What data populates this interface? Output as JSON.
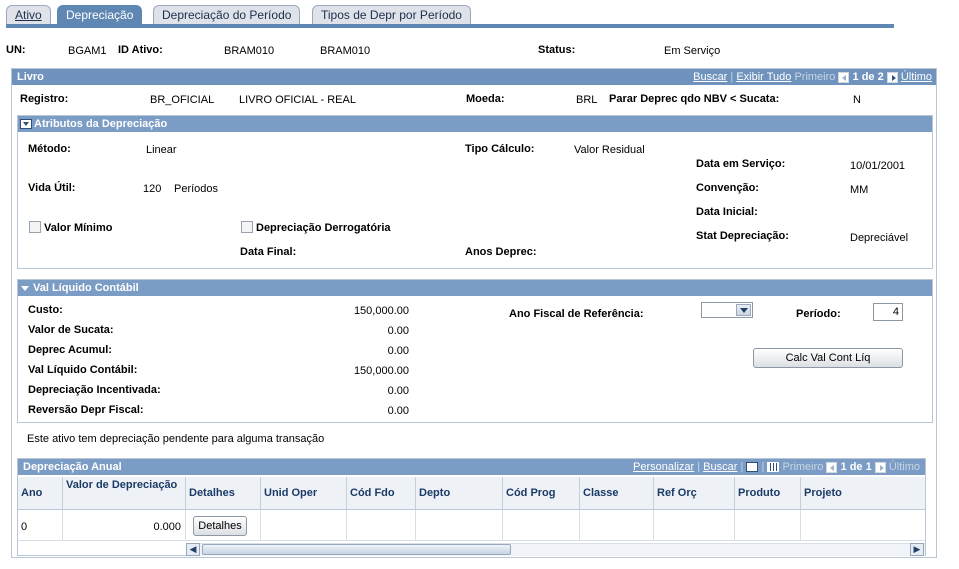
{
  "tabs": [
    {
      "label": "Ativo"
    },
    {
      "label": "Depreciação"
    },
    {
      "label": "Depreciação do Período"
    },
    {
      "label": "Tipos de Depr por Período"
    }
  ],
  "top": {
    "un_label": "UN:",
    "un_value": "BGAM1",
    "asset_label": "ID Ativo:",
    "asset_value": "BRAM010",
    "asset_value2": "BRAM010",
    "status_label": "Status:",
    "status_value": "Em Serviço"
  },
  "livro": {
    "title": "Livro",
    "nav": {
      "search": "Buscar",
      "view_all": "Exibir Tudo",
      "first": "Primeiro",
      "count": "1 de 2",
      "last": "Último"
    },
    "registro_label": "Registro:",
    "registro_code": "BR_OFICIAL",
    "registro_desc": "LIVRO OFICIAL - REAL",
    "moeda_label": "Moeda:",
    "moeda_value": "BRL",
    "parar_label": "Parar Deprec qdo NBV < Sucata:",
    "parar_value": "N"
  },
  "atributos": {
    "title": "Atributos da Depreciação",
    "metodo_label": "Método:",
    "metodo_value": "Linear",
    "tipo_calc_label": "Tipo Cálculo:",
    "tipo_calc_value": "Valor Residual",
    "data_servico_label": "Data em Serviço:",
    "data_servico_value": "10/01/2001",
    "vida_util_label": "Vida Útil:",
    "vida_util_value": "120",
    "vida_util_unit": "Períodos",
    "convencao_label": "Convenção:",
    "convencao_value": "MM",
    "data_inicial_label": "Data Inicial:",
    "valor_minimo_label": "Valor Mínimo",
    "derrogatoria_label": "Depreciação Derrogatória",
    "stat_dep_label": "Stat Depreciação:",
    "stat_dep_value": "Depreciável",
    "data_final_label": "Data Final:",
    "anos_deprec_label": "Anos Deprec:"
  },
  "valor_liquido": {
    "title": "Val Líquido Contábil",
    "rows": [
      {
        "label": "Custo:",
        "value": "150,000.00"
      },
      {
        "label": "Valor de Sucata:",
        "value": "0.00"
      },
      {
        "label": "Deprec Acumul:",
        "value": "0.00"
      },
      {
        "label": "Val Líquido Contábil:",
        "value": "150,000.00"
      },
      {
        "label": "Depreciação Incentivada:",
        "value": "0.00"
      },
      {
        "label": "Reversão Depr Fiscal:",
        "value": "0.00"
      }
    ],
    "ano_fiscal_label": "Ano Fiscal de Referência:",
    "ano_fiscal_value": "",
    "periodo_label": "Período:",
    "periodo_value": "4",
    "calc_button": "Calc Val Cont Líq"
  },
  "pending_message": "Este ativo tem depreciação pendente para alguma transação",
  "anual": {
    "title": "Depreciação Anual",
    "nav": {
      "personalize": "Personalizar",
      "search": "Buscar",
      "first": "Primeiro",
      "count": "1 de 1",
      "last": "Último"
    },
    "columns": [
      "Ano",
      "Valor de Depreciação",
      "Detalhes",
      "Unid Oper",
      "Cód Fdo",
      "Depto",
      "Cód Prog",
      "Classe",
      "Ref Orç",
      "Produto",
      "Projeto"
    ],
    "row": {
      "ano": "0",
      "valor": "0.000",
      "details_button": "Detalhes"
    }
  },
  "colors": {
    "header": "#6f93bc",
    "subheader": "#7b9cc4",
    "tab_active": "#5f87b4",
    "link": "#1a4f9c"
  }
}
